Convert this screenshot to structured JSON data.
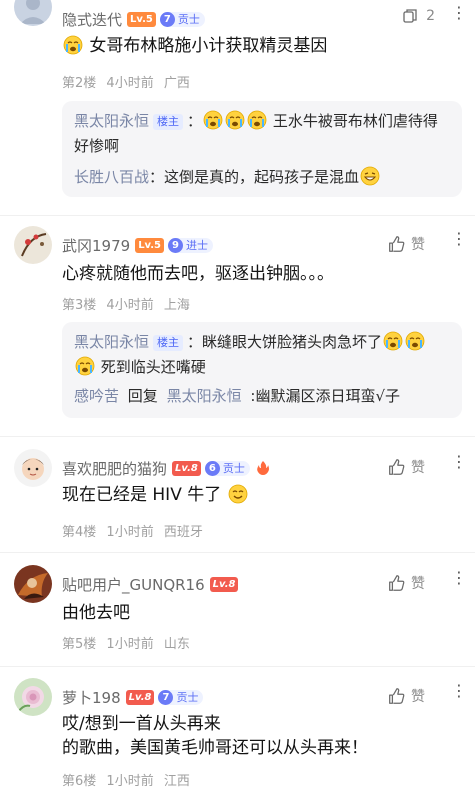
{
  "posts": [
    {
      "user": "隐式迭代",
      "level": "Lv.5",
      "badge_num": "7",
      "badge_label": "贡士",
      "like_count": "2",
      "body": "女哥布林略施小计获取精灵基因",
      "floor": "第2楼",
      "time": "4小时前",
      "location": "广西",
      "replies": [
        {
          "user": "黑太阳永恒",
          "tag": "楼主",
          "text": "王水牛被哥布林们虐待得好惨啊"
        },
        {
          "user": "长胜八百战",
          "text": "：这倒是真的，起码孩子是混血"
        }
      ]
    },
    {
      "user": "武冈1979",
      "level": "Lv.5",
      "badge_num": "9",
      "badge_label": "进士",
      "like_label": "赞",
      "body": "心疼就随他而去吧，驱逐出钟胭。。。",
      "floor": "第3楼",
      "time": "4小时前",
      "location": "上海",
      "replies": [
        {
          "user": "黑太阳永恒",
          "tag": "楼主",
          "text1": "眯缝眼大饼脸猪头肉急坏了",
          "text2": "死到临头还嘴硬"
        },
        {
          "user": "感吟苦",
          "reply_word": "回复",
          "target": "黑太阳永恒",
          "text": ":幽默漏区添日珥蛮√子"
        }
      ]
    },
    {
      "user": "喜欢肥肥的猫狗",
      "level": "Lv.8",
      "badge_num": "6",
      "badge_label": "贡士",
      "like_label": "赞",
      "body": "现在已经是 HIV 牛了",
      "floor": "第4楼",
      "time": "1小时前",
      "location": "西班牙"
    },
    {
      "user": "贴吧用户_GUNQR16",
      "level": "Lv.8",
      "like_label": "赞",
      "body": "由他去吧",
      "floor": "第5楼",
      "time": "1小时前",
      "location": "山东"
    },
    {
      "user": "萝卜198",
      "level": "Lv.8",
      "badge_num": "7",
      "badge_label": "贡士",
      "like_label": "赞",
      "body1": "哎/想到一首从头再来",
      "body2": "的歌曲，美国黄毛帅哥还可以从头再来！",
      "floor": "第6楼",
      "time": "1小时前",
      "location": "江西"
    }
  ],
  "colors": {
    "accent": "#4d67f5",
    "muted": "#a0a0a0",
    "reply_bg": "#f5f5f7"
  },
  "icons": [
    "avatar",
    "copy-icon",
    "thumb-up-icon",
    "more-vertical-icon",
    "crying-emoji",
    "grin-emoji",
    "smile-emoji"
  ]
}
